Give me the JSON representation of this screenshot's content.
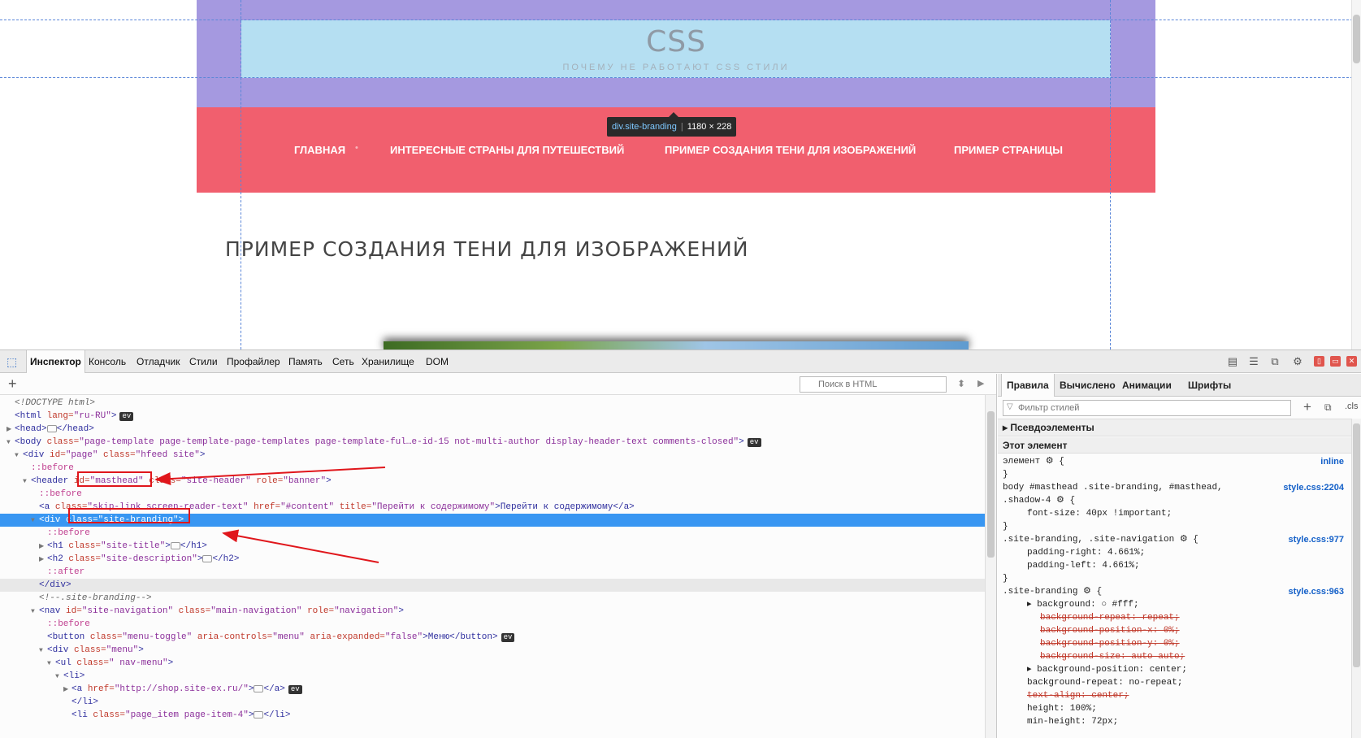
{
  "site": {
    "title": "CSS",
    "description": "ПОЧЕМУ НЕ РАБОТАЮТ CSS СТИЛИ",
    "nav": [
      "ГЛАВНАЯ",
      "ИНТЕРЕСНЫЕ СТРАНЫ ДЛЯ ПУТЕШЕСТВИЙ",
      "ПРИМЕР СОЗДАНИЯ ТЕНИ ДЛЯ ИЗОБРАЖЕНИЙ",
      "ПРИМЕР СТРАНИЦЫ"
    ],
    "nav_separator": "•",
    "heading": "ПРИМЕР СОЗДАНИЯ ТЕНИ ДЛЯ ИЗОБРАЖЕНИЙ"
  },
  "tooltip": {
    "selector": "div.site-branding",
    "size": "1180 × 228"
  },
  "devtools": {
    "tabs": [
      "Инспектор",
      "Консоль",
      "Отладчик",
      "Стили",
      "Профайлер",
      "Память",
      "Сеть",
      "Хранилище",
      "DOM"
    ],
    "active_tab": "Инспектор",
    "search_placeholder": "Поиск в HTML",
    "markup": [
      {
        "parts": [
          [
            "cm",
            "<!DOCTYPE html>"
          ]
        ]
      },
      {
        "parts": [
          [
            "tg",
            "<html "
          ],
          [
            "an",
            "lang="
          ],
          [
            "av",
            "\"ru-RU\""
          ],
          [
            "tg",
            ">"
          ]
        ],
        "ev": "ev"
      },
      {
        "parts": [
          [
            "tg",
            "<head>"
          ],
          [
            "coll",
            ""
          ],
          [
            "tg",
            "</head>"
          ]
        ]
      },
      {
        "parts": [
          [
            "tg",
            "<body "
          ],
          [
            "an",
            "class="
          ],
          [
            "av",
            "\"page-template page-template-page-templates page-template-ful…e-id-15 not-multi-author display-header-text comments-closed\""
          ],
          [
            "tg",
            ">"
          ]
        ],
        "ev": "ev"
      },
      {
        "parts": [
          [
            "tg",
            "<div "
          ],
          [
            "an",
            "id="
          ],
          [
            "av",
            "\"page\""
          ],
          [
            "an",
            " class="
          ],
          [
            "av",
            "\"hfeed site\""
          ],
          [
            "tg",
            ">"
          ]
        ]
      },
      {
        "parts": [
          [
            "ps",
            "::before"
          ]
        ]
      },
      {
        "parts": [
          [
            "tg",
            "<header "
          ],
          [
            "an",
            "id="
          ],
          [
            "av",
            "\"masthead\""
          ],
          [
            "an",
            " class="
          ],
          [
            "av",
            "\"site-header\""
          ],
          [
            "an",
            " role="
          ],
          [
            "av",
            "\"banner\""
          ],
          [
            "tg",
            ">"
          ]
        ]
      },
      {
        "parts": [
          [
            "ps",
            "::before"
          ]
        ]
      },
      {
        "parts": [
          [
            "tg",
            "<a "
          ],
          [
            "an",
            "class="
          ],
          [
            "av",
            "\"skip-link screen-reader-text\""
          ],
          [
            "an",
            " href="
          ],
          [
            "av",
            "\"#content\""
          ],
          [
            "an",
            " title="
          ],
          [
            "av",
            "\"Перейти к содержимому\""
          ],
          [
            "tg",
            ">Перейти к содержимому</a>"
          ]
        ]
      },
      {
        "parts": [
          [
            "tg",
            "<div "
          ],
          [
            "an",
            "class="
          ],
          [
            "av",
            "\"site-branding\""
          ],
          [
            "tg",
            ">"
          ]
        ]
      },
      {
        "parts": [
          [
            "ps",
            "::before"
          ]
        ]
      },
      {
        "parts": [
          [
            "tg",
            "<h1 "
          ],
          [
            "an",
            "class="
          ],
          [
            "av",
            "\"site-title\""
          ],
          [
            "tg",
            ">"
          ],
          [
            "coll",
            ""
          ],
          [
            "tg",
            "</h1>"
          ]
        ]
      },
      {
        "parts": [
          [
            "tg",
            "<h2 "
          ],
          [
            "an",
            "class="
          ],
          [
            "av",
            "\"site-description\""
          ],
          [
            "tg",
            ">"
          ],
          [
            "coll",
            ""
          ],
          [
            "tg",
            "</h2>"
          ]
        ]
      },
      {
        "parts": [
          [
            "ps",
            "::after"
          ]
        ]
      },
      {
        "parts": [
          [
            "tg",
            "</div>"
          ]
        ]
      },
      {
        "parts": [
          [
            "cm",
            "<!--.site-branding-->"
          ]
        ]
      },
      {
        "parts": [
          [
            "tg",
            "<nav "
          ],
          [
            "an",
            "id="
          ],
          [
            "av",
            "\"site-navigation\""
          ],
          [
            "an",
            " class="
          ],
          [
            "av",
            "\"main-navigation\""
          ],
          [
            "an",
            " role="
          ],
          [
            "av",
            "\"navigation\""
          ],
          [
            "tg",
            ">"
          ]
        ]
      },
      {
        "parts": [
          [
            "ps",
            "::before"
          ]
        ]
      },
      {
        "parts": [
          [
            "tg",
            "<button "
          ],
          [
            "an",
            "class="
          ],
          [
            "av",
            "\"menu-toggle\""
          ],
          [
            "an",
            " aria-controls="
          ],
          [
            "av",
            "\"menu\""
          ],
          [
            "an",
            " aria-expanded="
          ],
          [
            "av",
            "\"false\""
          ],
          [
            "tg",
            ">Меню</button>"
          ]
        ],
        "ev": "ev"
      },
      {
        "parts": [
          [
            "tg",
            "<div "
          ],
          [
            "an",
            "class="
          ],
          [
            "av",
            "\"menu\""
          ],
          [
            "tg",
            ">"
          ]
        ]
      },
      {
        "parts": [
          [
            "tg",
            "<ul "
          ],
          [
            "an",
            "class="
          ],
          [
            "av",
            "\" nav-menu\""
          ],
          [
            "tg",
            ">"
          ]
        ]
      },
      {
        "parts": [
          [
            "tg",
            "<li>"
          ]
        ]
      },
      {
        "parts": [
          [
            "tg",
            "<a "
          ],
          [
            "an",
            "href="
          ],
          [
            "av",
            "\"http://shop.site-ex.ru/\""
          ],
          [
            "tg",
            ">"
          ],
          [
            "coll",
            ""
          ],
          [
            "tg",
            "</a>"
          ]
        ],
        "ev": "ev"
      },
      {
        "parts": [
          [
            "tg",
            "</li>"
          ]
        ]
      },
      {
        "parts": [
          [
            "tg",
            "<li "
          ],
          [
            "an",
            "class="
          ],
          [
            "av",
            "\"page_item page-item-4\""
          ],
          [
            "tg",
            ">"
          ],
          [
            "coll",
            ""
          ],
          [
            "tg",
            "</li>"
          ]
        ]
      }
    ],
    "side_tabs": [
      "Правила",
      "Вычислено",
      "Анимации",
      "Шрифты"
    ],
    "filter_placeholder": "Фильтр стилей",
    "cls_label": ".cls",
    "pseudo_label": "Псевдоэлементы",
    "this_element_label": "Этот элемент",
    "rules": [
      {
        "text": "элемент ⚙ {",
        "src": "inline"
      },
      {
        "text": "}"
      },
      {
        "text": "body #masthead .site-branding, #masthead,",
        "src": "style.css:2204"
      },
      {
        "text": ".shadow-4 ⚙ {"
      },
      {
        "text": "font-size: 40px !important;",
        "ind": 1
      },
      {
        "text": "}"
      },
      {
        "text": ".site-branding, .site-navigation ⚙ {",
        "src": "style.css:977"
      },
      {
        "text": "padding-right: 4.661%;",
        "ind": 1
      },
      {
        "text": "padding-left: 4.661%;",
        "ind": 1
      },
      {
        "text": "}"
      },
      {
        "text": ".site-branding ⚙ {",
        "src": "style.css:963"
      },
      {
        "text": "▸ background: ○ #fff;",
        "ind": 1
      },
      {
        "text": "background-repeat: repeat;",
        "ind": 2,
        "strike": true
      },
      {
        "text": "background-position-x: 0%;",
        "ind": 2,
        "strike": true
      },
      {
        "text": "background-position-y: 0%;",
        "ind": 2,
        "strike": true
      },
      {
        "text": "background-size: auto auto;",
        "ind": 2,
        "strike": true
      },
      {
        "text": "▸ background-position: center;",
        "ind": 1
      },
      {
        "text": "background-repeat: no-repeat;",
        "ind": 1
      },
      {
        "text": "text-align: center;",
        "ind": 1,
        "strike": true
      },
      {
        "text": "height: 100%;",
        "ind": 1
      },
      {
        "text": "min-height: 72px;",
        "ind": 1
      }
    ]
  }
}
